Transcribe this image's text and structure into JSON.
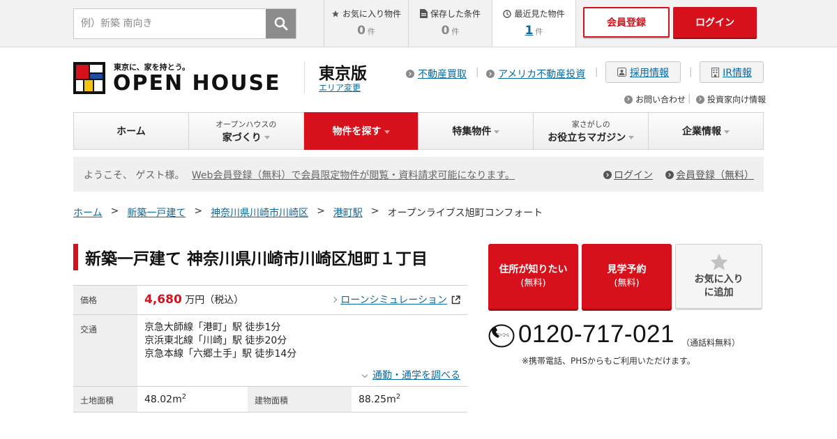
{
  "topbar": {
    "search_placeholder": "例）新築 南向き",
    "favorites": {
      "label": "お気に入り物件",
      "count": "0",
      "unit": "件"
    },
    "saved": {
      "label": "保存した条件",
      "count": "0",
      "unit": "件"
    },
    "recent": {
      "label": "最近見た物件",
      "count": "1",
      "unit": "件"
    },
    "register_label": "会員登録",
    "login_label": "ログイン"
  },
  "header": {
    "logo_tagline": "東京に、家を持とう。",
    "logo_text": "OPEN HOUSE",
    "edition": "東京版",
    "area_change": "エリア変更",
    "links": [
      "不動産買取",
      "アメリカ不動産投資"
    ],
    "recruit_label": "採用情報",
    "ir_label": "IR情報",
    "contact_label": "お問い合わせ",
    "investor_label": "投資家向け情報"
  },
  "nav": {
    "home": "ホーム",
    "house_small": "オープンハウスの",
    "house": "家づくり",
    "search": "物件を探す",
    "special": "特集物件",
    "magazine_small": "家さがしの",
    "magazine": "お役立ちマガジン",
    "company": "企業情報"
  },
  "welcome": {
    "greeting": "ようこそ、 ゲスト様。",
    "promo": "Web会員登録（無料）で会員限定物件が閲覧・資料請求可能になります。",
    "login": "ログイン",
    "register": "会員登録（無料）"
  },
  "breadcrumb": {
    "items": [
      "ホーム",
      "新築一戸建て",
      "神奈川県川崎市川崎区",
      "港町駅"
    ],
    "current": "オープンライブス旭町コンフォート",
    "separator": ">"
  },
  "property": {
    "title": "新築一戸建て 神奈川県川崎市川崎区旭町１丁目",
    "price_label": "価格",
    "price_value": "4,680",
    "price_unit": "万円（税込）",
    "loan_link": "ローンシミュレーション",
    "access_label": "交通",
    "access": [
      "京急大師線「港町」駅 徒歩1分",
      "京浜東北線「川崎」駅 徒歩20分",
      "京急本線「六郷土手」駅 徒歩14分"
    ],
    "commute_link": "通勤・通学を調べる",
    "land_label": "土地面積",
    "land_value": "48.02m",
    "building_label": "建物面積",
    "building_value": "88.25m",
    "sup": "2"
  },
  "cta": {
    "address_title": "住所が知りたい",
    "address_sub": "(無料)",
    "visit_title": "見学予約",
    "visit_sub": "(無料)",
    "favorite_line1": "お気に入り",
    "favorite_line2": "に追加"
  },
  "phone": {
    "icon_text": "フリーコール",
    "number": "0120-717-021",
    "note": "（通話料無料）",
    "sub": "※携帯電話、PHSからもご利用いただけます。"
  },
  "colors": {
    "accent": "#d7111b",
    "link": "#0a6aa1"
  }
}
